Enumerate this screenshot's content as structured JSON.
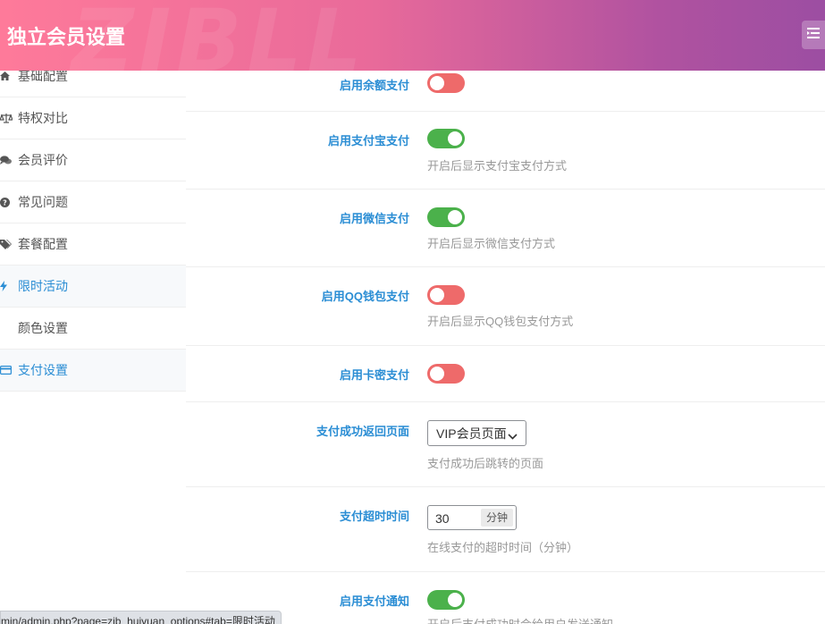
{
  "header": {
    "title": "独立会员设置",
    "watermark": "ZIBLL",
    "menu_icon": "collapse-menu-icon"
  },
  "sidebar": {
    "items": [
      {
        "label": "基础配置",
        "icon": "home-icon"
      },
      {
        "label": "特权对比",
        "icon": "balance-scale-icon"
      },
      {
        "label": "会员评价",
        "icon": "comments-icon"
      },
      {
        "label": "常见问题",
        "icon": "question-circle-icon"
      },
      {
        "label": "套餐配置",
        "icon": "tags-icon"
      },
      {
        "label": "限时活动",
        "icon": "bolt-icon"
      },
      {
        "label": "颜色设置",
        "icon": ""
      },
      {
        "label": "支付设置",
        "icon": "credit-card-icon"
      }
    ]
  },
  "settings": {
    "balance_pay": {
      "label": "启用余额支付",
      "enabled": false
    },
    "alipay": {
      "label": "启用支付宝支付",
      "enabled": true,
      "desc": "开启后显示支付宝支付方式"
    },
    "wechat_pay": {
      "label": "启用微信支付",
      "enabled": true,
      "desc": "开启后显示微信支付方式"
    },
    "qq_pay": {
      "label": "启用QQ钱包支付",
      "enabled": false,
      "desc": "开启后显示QQ钱包支付方式"
    },
    "card_pay": {
      "label": "启用卡密支付",
      "enabled": false
    },
    "return_page": {
      "label": "支付成功返回页面",
      "value": "VIP会员页面",
      "desc": "支付成功后跳转的页面"
    },
    "timeout": {
      "label": "支付超时时间",
      "value": "30",
      "unit": "分钟",
      "desc": "在线支付的超时时间（分钟）"
    },
    "notify": {
      "label": "启用支付通知",
      "enabled": true,
      "desc": "开启后支付成功时会给用户发送通知"
    }
  },
  "statusbar": {
    "url": "min/admin.php?page=zib_huiyuan_options#tab=限时活动"
  },
  "colors": {
    "accent": "#2a8dd4",
    "toggle_on": "#4bb14b",
    "toggle_off": "#ee6a6a"
  }
}
